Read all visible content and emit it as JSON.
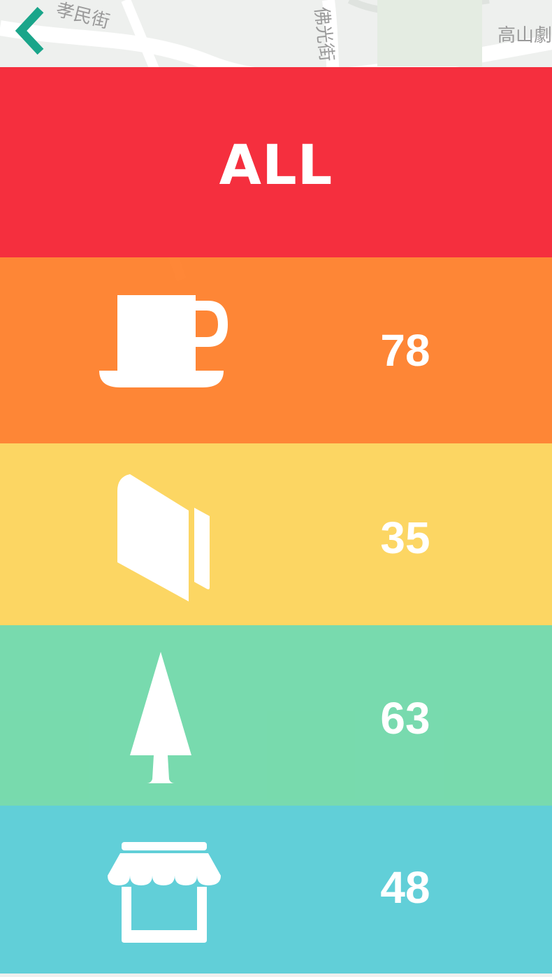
{
  "map": {
    "street_labels": [
      "孝民街",
      "佛光街",
      "高山劇"
    ]
  },
  "navigation": {
    "back_icon": "chevron-left-icon",
    "back_color": "#1aa58a"
  },
  "categories": [
    {
      "id": "all",
      "label": "ALL",
      "color": "#f52838"
    },
    {
      "id": "cafe",
      "icon": "coffee-cup-icon",
      "count": "78",
      "color": "#ff7d26"
    },
    {
      "id": "book",
      "icon": "book-icon",
      "count": "35",
      "color": "#fdd458"
    },
    {
      "id": "park",
      "icon": "tree-icon",
      "count": "63",
      "color": "#6ed8a8"
    },
    {
      "id": "shop",
      "icon": "storefront-icon",
      "count": "48",
      "color": "#56ccd6"
    }
  ]
}
